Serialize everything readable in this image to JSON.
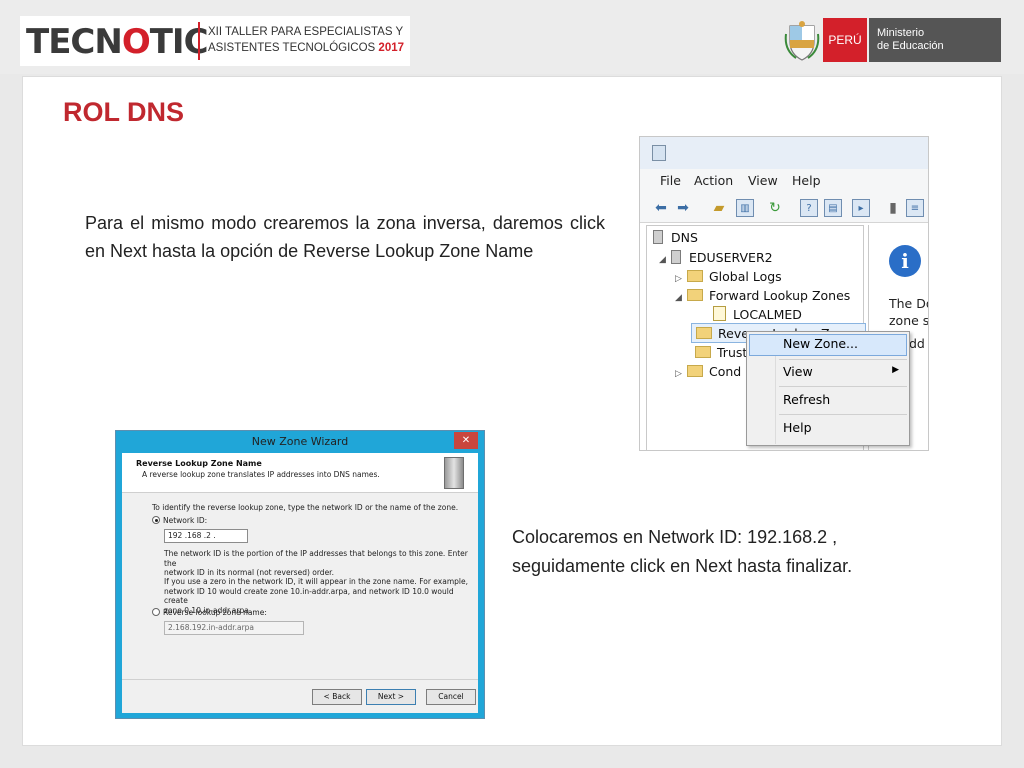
{
  "header": {
    "logo_part1": "TECN",
    "logo_o": "O",
    "logo_part2": "TIC",
    "event_line1": "XII TALLER PARA  ESPECIALISTAS  Y",
    "event_line2": "ASISTENTES TECNOLÓGICOS",
    "event_year": "2017",
    "country": "PERÚ",
    "ministry_line1": "Ministerio",
    "ministry_line2": "de Educación",
    "colors": {
      "brand_red": "#d3202a",
      "ministry_gray": "#555555"
    }
  },
  "slide": {
    "title": "ROL DNS",
    "paragraph1": "Para el mismo modo crearemos la zona inversa, daremos click en Next hasta la opción  de Reverse Lookup Zone Name",
    "paragraph2": "Colocaremos en Network ID: 192.168.2 , seguidamente click en Next hasta finalizar."
  },
  "dns_console": {
    "menu": [
      "File",
      "Action",
      "View",
      "Help"
    ],
    "tree": {
      "root": "DNS",
      "server": "EDUSERVER2",
      "global_logs": "Global Logs",
      "forward_zones": "Forward Lookup Zones",
      "zone_localmed": "LOCALMED",
      "reverse_zones": "Reverse Lookup Zones",
      "trust": "Trust",
      "cond": "Cond"
    },
    "right_pane": {
      "line1": "The Dor",
      "line2": "zone sto",
      "line3": "dd"
    },
    "context_menu": {
      "new_zone": "New Zone...",
      "view": "View",
      "refresh": "Refresh",
      "help": "Help"
    }
  },
  "wizard": {
    "title": "New Zone Wizard",
    "close": "✕",
    "heading": "Reverse Lookup Zone Name",
    "subheading": "A reverse lookup zone translates IP addresses into DNS names.",
    "instruction": "To identify the reverse lookup zone, type the network ID or the name of the zone.",
    "network_id_label": "Network ID:",
    "network_id_value": "192 .168 .2     .",
    "note1_line1": "The network ID is the portion of the IP addresses that belongs to this zone. Enter the",
    "note1_line2": "network ID in its normal (not reversed) order.",
    "note2_line1": "If you use a zero in the network ID, it will appear in the zone name. For example,",
    "note2_line2": "network ID 10 would create zone 10.in-addr.arpa, and network ID 10.0 would create",
    "note2_line3": "zone 0.10.in-addr.arpa.",
    "zone_name_label": "Reverse lookup zone name:",
    "zone_name_value": "2.168.192.in-addr.arpa",
    "buttons": {
      "back": "< Back",
      "next": "Next >",
      "cancel": "Cancel"
    }
  }
}
